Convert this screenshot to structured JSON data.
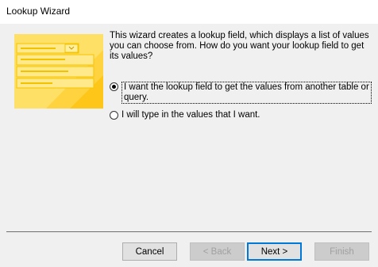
{
  "window": {
    "title": "Lookup Wizard"
  },
  "description": "This wizard creates a lookup field, which displays a list of values you can choose from.  How do you want your lookup field to get its values?",
  "options": [
    {
      "label": "I want the lookup field to get the values from another table or query.",
      "selected": true
    },
    {
      "label": "I will type in the values that I want.",
      "selected": false
    }
  ],
  "buttons": {
    "cancel": "Cancel",
    "back": "< Back",
    "next": "Next >",
    "finish": "Finish"
  },
  "colors": {
    "illustration_yellow": "#fdd835",
    "accent": "#0078d7"
  }
}
